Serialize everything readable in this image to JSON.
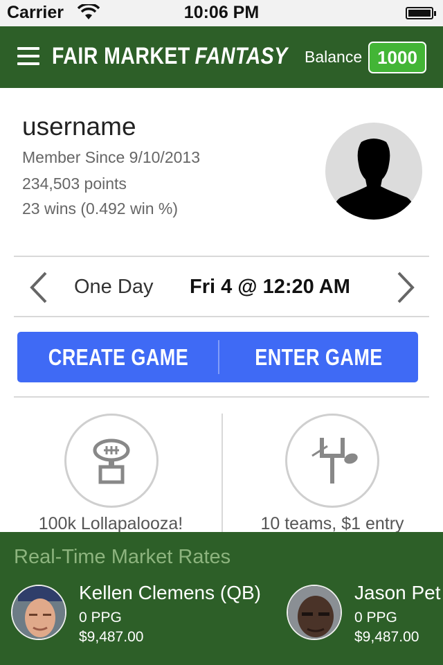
{
  "status_bar": {
    "carrier": "Carrier",
    "time": "10:06 PM"
  },
  "header": {
    "brand_main": "FAIR MARKET",
    "brand_accent": "FANTASY",
    "balance_label": "Balance",
    "balance_value": "1000",
    "colors": {
      "header_bg": "#2d5f28",
      "badge_bg": "#43b536"
    }
  },
  "profile": {
    "username": "username",
    "member_since": "Member Since 9/10/2013",
    "points": "234,503 points",
    "wins": "23 wins (0.492 win %)",
    "avatar_icon": "person-silhouette-icon"
  },
  "schedule": {
    "period": "One Day",
    "date": "Fri 4 @ 12:20 AM"
  },
  "actions": {
    "create_label": "CREATE GAME",
    "enter_label": "ENTER GAME",
    "color": "#3f6af5"
  },
  "cards": [
    {
      "label": "100k Lollapalooza!",
      "icon": "football-trophy-icon"
    },
    {
      "label": "10 teams, $1 entry",
      "icon": "goalpost-football-icon"
    }
  ],
  "market": {
    "title": "Real-Time Market Rates",
    "players": [
      {
        "name": "Kellen Clemens (QB)",
        "ppg": "0 PPG",
        "price": "$9,487.00"
      },
      {
        "name": "Jason Pet",
        "ppg": "0 PPG",
        "price": "$9,487.00"
      }
    ]
  }
}
